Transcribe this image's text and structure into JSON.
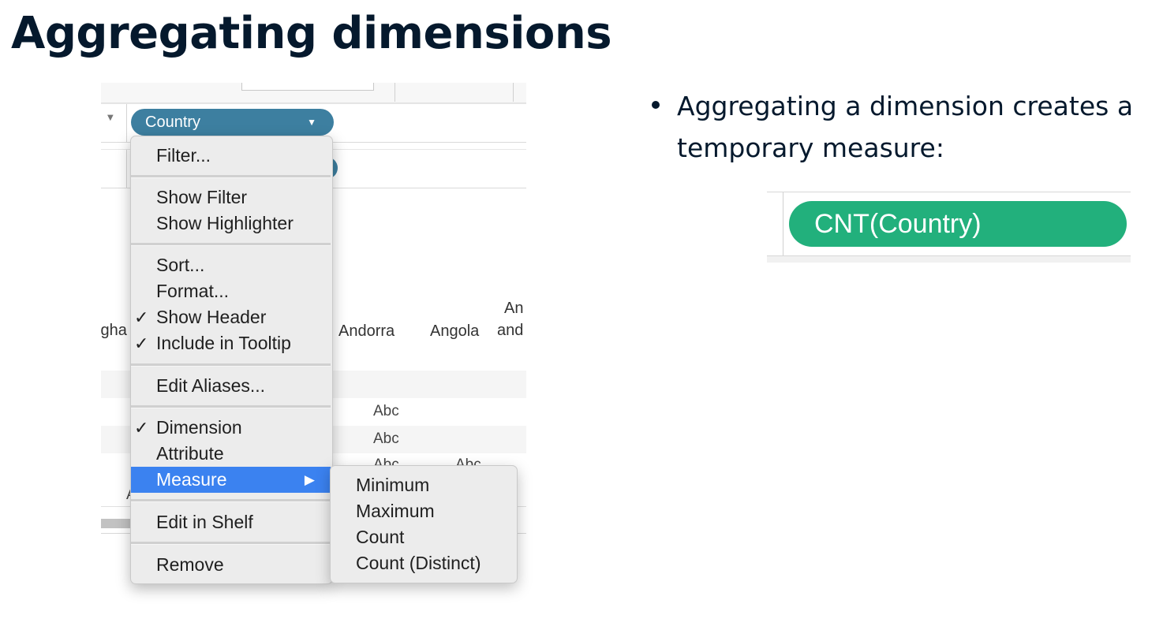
{
  "slide": {
    "title": "Aggregating dimensions",
    "bullet": "Aggregating a dimension creates a temporary measure:"
  },
  "tableau": {
    "pill_label": "Country",
    "column_headers": [
      "fgha",
      "Andorra",
      "Angola",
      "An",
      "and"
    ],
    "cells": [
      "Abc",
      "Abc",
      "Abc",
      "Abc"
    ],
    "partial_letter": "A"
  },
  "menu": {
    "items": [
      {
        "label": "Filter...",
        "checked": false
      },
      {
        "label": "Show Filter",
        "checked": false
      },
      {
        "label": "Show Highlighter",
        "checked": false
      },
      {
        "label": "Sort...",
        "checked": false
      },
      {
        "label": "Format...",
        "checked": false
      },
      {
        "label": "Show Header",
        "checked": true
      },
      {
        "label": "Include in Tooltip",
        "checked": true
      },
      {
        "label": "Edit Aliases...",
        "checked": false
      },
      {
        "label": "Dimension",
        "checked": true
      },
      {
        "label": "Attribute",
        "checked": false
      },
      {
        "label": "Measure",
        "checked": false,
        "active": true,
        "submenu_arrow": "▶"
      },
      {
        "label": "Edit in Shelf",
        "checked": false
      },
      {
        "label": "Remove",
        "checked": false
      }
    ],
    "check_glyph": "✓",
    "submenu": [
      "Minimum",
      "Maximum",
      "Count",
      "Count (Distinct)"
    ]
  },
  "result_pill": {
    "label": "CNT(Country)",
    "color": "#22b07c"
  },
  "colors": {
    "dimension_pill": "#3d7fa0",
    "menu_highlight": "#3b82f0",
    "title": "#05192d"
  }
}
